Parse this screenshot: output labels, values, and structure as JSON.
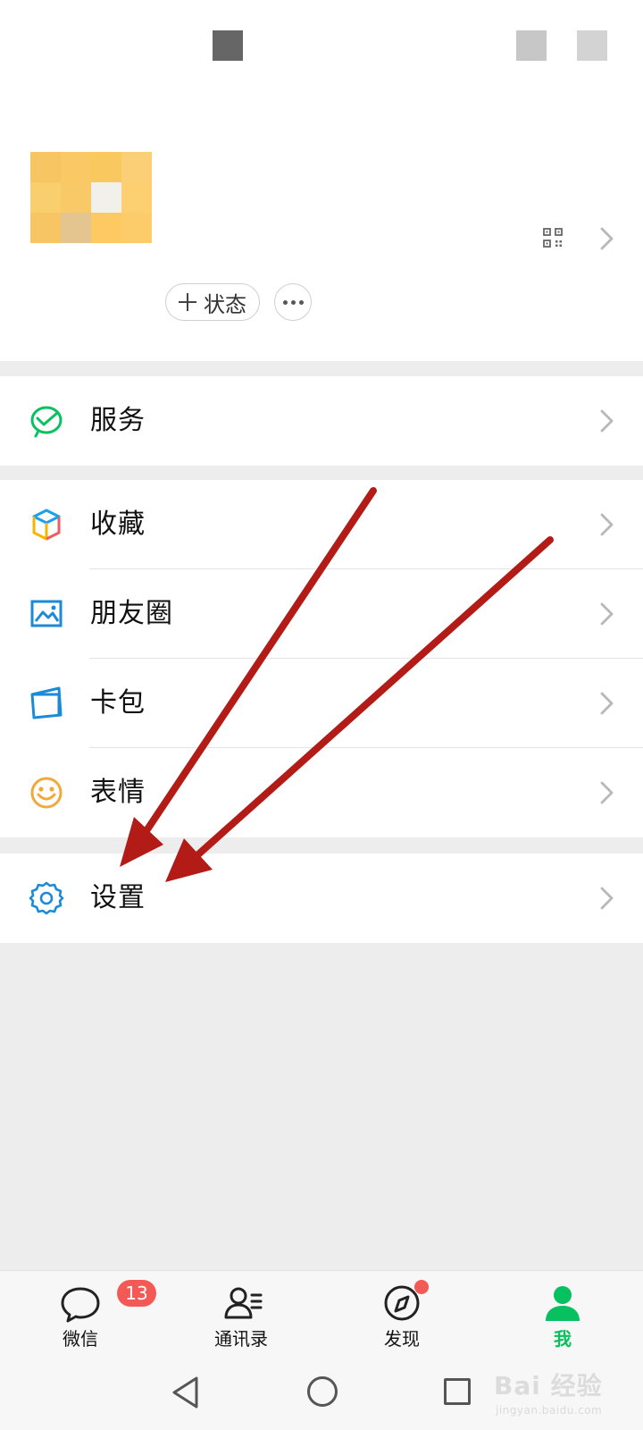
{
  "profile": {
    "status_button_label": "状态"
  },
  "menu": {
    "service": {
      "label": "服务",
      "icon": "service-icon"
    },
    "favorites": {
      "label": "收藏",
      "icon": "cube-icon"
    },
    "moments": {
      "label": "朋友圈",
      "icon": "image-icon"
    },
    "cards": {
      "label": "卡包",
      "icon": "wallet-icon"
    },
    "stickers": {
      "label": "表情",
      "icon": "smile-icon"
    },
    "settings": {
      "label": "设置",
      "icon": "gear-icon"
    }
  },
  "tabs": {
    "chats": {
      "label": "微信",
      "badge": "13",
      "icon": "chat-icon"
    },
    "contacts": {
      "label": "通讯录",
      "icon": "contacts-icon"
    },
    "discover": {
      "label": "发现",
      "icon": "compass-icon"
    },
    "me": {
      "label": "我",
      "icon": "person-icon"
    }
  },
  "watermark": {
    "brand": "Bai 经验",
    "url": "jingyan.baidu.com"
  },
  "colors": {
    "accent_green": "#07c160",
    "badge_red": "#f35a56",
    "arrow_red": "#b31b17"
  }
}
